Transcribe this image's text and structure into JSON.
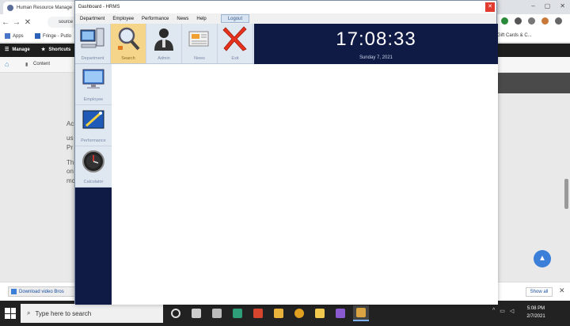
{
  "browser": {
    "tab_title": "Human Resource Manage",
    "omnibox_text": "source",
    "bookmarks": [
      {
        "label": "Apps"
      },
      {
        "label": "Fringe - Putlo"
      },
      {
        "label": "Gift Cards & C..."
      }
    ],
    "wp_bar": {
      "manage": "Manage",
      "shortcuts": "Shortcuts"
    },
    "wp_sub": {
      "content": "Content"
    },
    "page_snippets": [
      "Ac",
      "us",
      "Pr",
      "Th",
      "on",
      "mc"
    ],
    "download": {
      "file": "Download video Bros",
      "show_all": "Show all",
      "close": "✕"
    }
  },
  "taskbar": {
    "search_placeholder": "Type here to search",
    "time": "5:08 PM",
    "date": "2/7/2021"
  },
  "app": {
    "title": "Dashboard - HRMS",
    "close": "✕",
    "menu": [
      "Department",
      "Employee",
      "Performance",
      "News",
      "Help"
    ],
    "logout": "Logout",
    "toolbar": [
      {
        "label": "Department",
        "icon": "computer-icon"
      },
      {
        "label": "Search",
        "icon": "magnifier-icon"
      },
      {
        "label": "Admin",
        "icon": "admin-user-icon"
      },
      {
        "label": "News",
        "icon": "news-icon"
      },
      {
        "label": "Exit",
        "icon": "exit-x-icon"
      }
    ],
    "clock": {
      "time": "17:08:33",
      "date": "Sunday 7, 2021"
    },
    "sidebar": [
      {
        "label": "Employee",
        "icon": "monitor-icon"
      },
      {
        "label": "Performance",
        "icon": "performance-icon"
      },
      {
        "label": "Calculator",
        "icon": "clock-gauge-icon"
      }
    ]
  },
  "colors": {
    "app_navy": "#0f1a45",
    "toolbar_bg": "#dfe7f1",
    "active_tool": "#f5d58a",
    "exit_red": "#e8321e"
  }
}
